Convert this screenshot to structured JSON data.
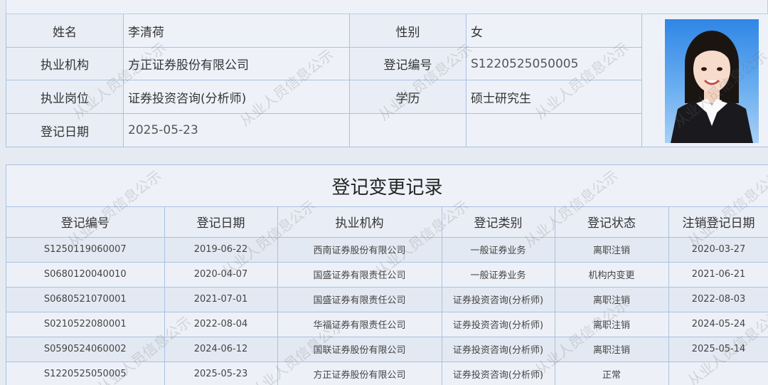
{
  "watermark_text": "从业人员信息公示",
  "info": {
    "labels": {
      "name": "姓名",
      "gender": "性别",
      "org": "执业机构",
      "reg_no": "登记编号",
      "position": "执业岗位",
      "education": "学历",
      "reg_date": "登记日期"
    },
    "values": {
      "name": "李清荷",
      "gender": "女",
      "org": "方正证券股份有限公司",
      "reg_no": "S1220525050005",
      "position": "证券投资咨询(分析师)",
      "education": "硕士研究生",
      "reg_date": "2025-05-23"
    }
  },
  "records": {
    "title": "登记变更记录",
    "columns": [
      "登记编号",
      "登记日期",
      "执业机构",
      "登记类别",
      "登记状态",
      "注销登记日期"
    ],
    "rows": [
      [
        "S1250119060007",
        "2019-06-22",
        "西南证券股份有限公司",
        "一般证券业务",
        "离职注销",
        "2020-03-27"
      ],
      [
        "S0680120040010",
        "2020-04-07",
        "国盛证券有限责任公司",
        "一般证券业务",
        "机构内变更",
        "2021-06-21"
      ],
      [
        "S0680521070001",
        "2021-07-01",
        "国盛证券有限责任公司",
        "证券投资咨询(分析师)",
        "离职注销",
        "2022-08-03"
      ],
      [
        "S0210522080001",
        "2022-08-04",
        "华福证券有限责任公司",
        "证券投资咨询(分析师)",
        "离职注销",
        "2024-05-24"
      ],
      [
        "S0590524060002",
        "2024-06-12",
        "国联证券股份有限公司",
        "证券投资咨询(分析师)",
        "离职注销",
        "2025-05-14"
      ],
      [
        "S1220525050005",
        "2025-05-23",
        "方正证券股份有限公司",
        "证券投资咨询(分析师)",
        "正常",
        ""
      ]
    ]
  }
}
